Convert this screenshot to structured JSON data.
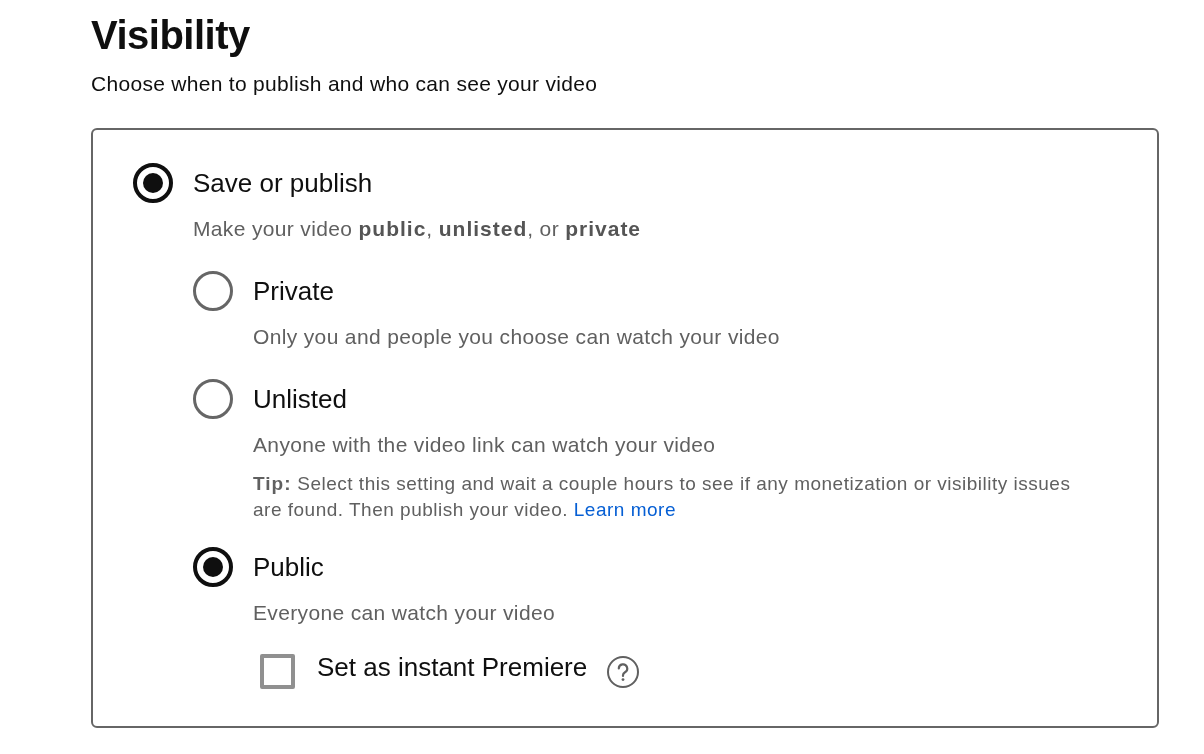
{
  "title": "Visibility",
  "subtitle": "Choose when to publish and who can see your video",
  "visibility": {
    "label": "Save or publish",
    "selected": true,
    "description": "Make your video **public**, **unlisted**, or **private**",
    "options": [
      {
        "label": "Private",
        "selected": false,
        "description": "Only you and people you choose can watch your video"
      },
      {
        "label": "Unlisted",
        "selected": false,
        "description": "Anyone with the video link can watch your video",
        "tip": {
          "text": "**Tip:** Select this setting and wait a couple hours to see if any monetization or visibility issues are found. Then publish your video.",
          "link": "Learn more"
        }
      },
      {
        "label": "Public",
        "selected": true,
        "description": "Everyone can watch your video",
        "premiere": {
          "label": "Set as instant Premiere",
          "checked": false
        }
      }
    ]
  }
}
